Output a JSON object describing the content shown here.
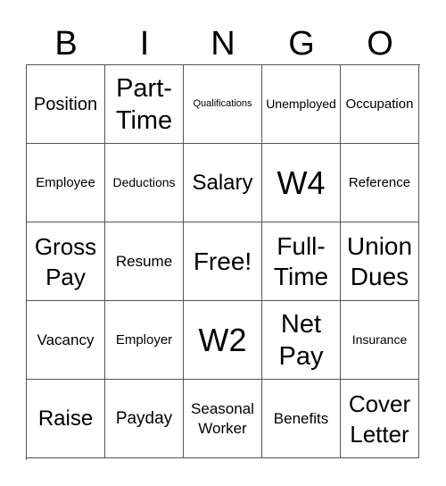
{
  "header": {
    "letters": [
      "B",
      "I",
      "N",
      "G",
      "O"
    ]
  },
  "board": {
    "rows": [
      [
        "Position",
        "Part-\nTime",
        "Qualifications",
        "Unemployed",
        "Occupation"
      ],
      [
        "Employee",
        "Deductions",
        "Salary",
        "W4",
        "Reference"
      ],
      [
        "Gross\nPay",
        "Resume",
        "Free!",
        "Full-\nTime",
        "Union\nDues"
      ],
      [
        "Vacancy",
        "Employer",
        "W2",
        "Net\nPay",
        "Insurance"
      ],
      [
        "Raise",
        "Payday",
        "Seasonal\nWorker",
        "Benefits",
        "Cover\nLetter"
      ]
    ]
  }
}
